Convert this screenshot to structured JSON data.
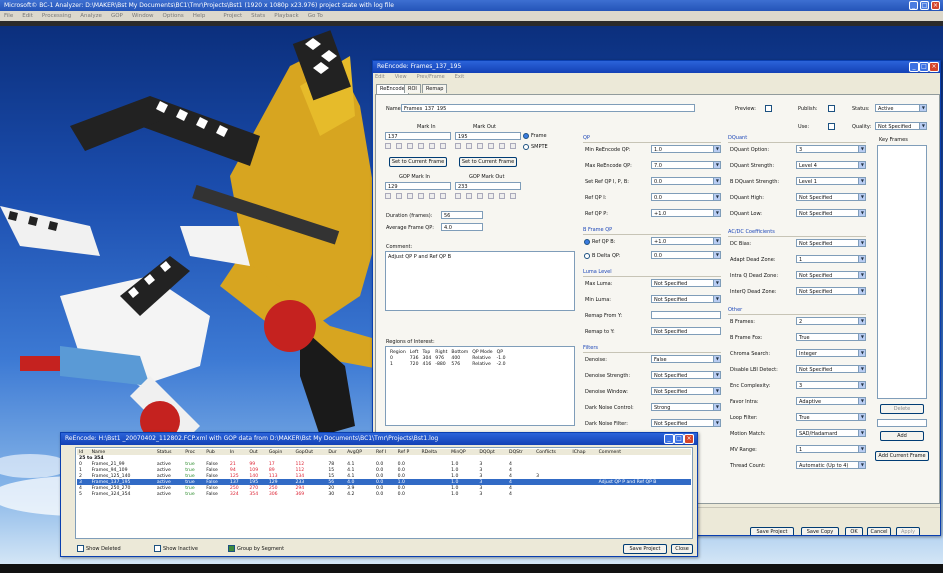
{
  "app": {
    "title": "Microsoft© BC-1 Analyzer: D:\\MAKER\\Bst  My Documents\\BC1\\Tmr\\Projects\\Bst1 (1920 x 1080p x23.976) project state with log file",
    "menu": [
      "File",
      "Edit",
      "Processing",
      "Analyze",
      "GOP",
      "Window",
      "Options",
      "Help",
      "",
      "Project",
      "Stats",
      "Playback",
      "Go To"
    ]
  },
  "reencode": {
    "title": "ReEncode: Frames_137_195",
    "menu": [
      "Edit",
      "View",
      "Prev/Frame",
      "Exit"
    ],
    "tabs": [
      "ReEncode",
      "ROI",
      "Remap"
    ],
    "name_label": "Name:",
    "name_value": "Frames_137_195",
    "mark_in_label": "Mark In",
    "mark_out_label": "Mark Out",
    "mark_in": "137",
    "mark_out": "195",
    "frame_label": "Frame",
    "smpte_label": "SMPTE",
    "set_current_label": "Set to Current Frame",
    "gop_in_label": "GOP Mark In",
    "gop_out_label": "GOP Mark Out",
    "gop_in": "129",
    "gop_out": "233",
    "duration_label": "Duration (frames):",
    "duration": "56",
    "avg_qp_label": "Average Frame QP:",
    "avg_qp": "4.0",
    "comment_label": "Comment:",
    "comment": "Adjust QP P and Ref QP B",
    "qp_group": "QP",
    "qp": [
      {
        "label": "Min ReEncode QP:",
        "value": "1.0"
      },
      {
        "label": "Max ReEncode QP:",
        "value": "7.0"
      },
      {
        "label": "Set Ref QP I, P, B:",
        "value": "0.0"
      },
      {
        "label": "Ref QP I:",
        "value": "0.0"
      },
      {
        "label": "Ref QP P:",
        "value": "+1.0"
      }
    ],
    "bframe_group": "B Frame QP",
    "bframe": [
      {
        "label": "Ref QP B:",
        "value": "+1.0"
      },
      {
        "label": "B Delta QP:",
        "value": "0.0"
      }
    ],
    "luma_group": "Luma Level",
    "luma": [
      {
        "label": "Max Luma:",
        "value": "Not Specified"
      },
      {
        "label": "Min Luma:",
        "value": "Not Specified"
      },
      {
        "label": "Remap From Y:",
        "value": ""
      },
      {
        "label": "Remap to Y:",
        "value": "Not Specified"
      }
    ],
    "filter_group": "Filters",
    "filters": [
      {
        "label": "Denoise:",
        "value": "False"
      },
      {
        "label": "Denoise Strength:",
        "value": "Not Specified"
      },
      {
        "label": "Denoise Window:",
        "value": "Not Specified"
      },
      {
        "label": "Dark Noise Control:",
        "value": "Strong"
      },
      {
        "label": "Dark Noise Filter:",
        "value": "Not Specified"
      }
    ],
    "dquant_group": "DQuant",
    "dquant": [
      {
        "label": "DQuant Option:",
        "value": "3"
      },
      {
        "label": "DQuant Strength:",
        "value": "Level 4"
      },
      {
        "label": "B DQuant Strength:",
        "value": "Level 1"
      },
      {
        "label": "DQuant High:",
        "value": "Not Specified"
      },
      {
        "label": "DQuant Low:",
        "value": "Not Specified"
      }
    ],
    "acdc_group": "AC/DC Coefficients",
    "acdc": [
      {
        "label": "DC Bias:",
        "value": "Not Specified"
      },
      {
        "label": "Adapt Dead Zone:",
        "value": "1"
      },
      {
        "label": "Intra Q Dead Zone:",
        "value": "Not Specified"
      },
      {
        "label": "InterQ Dead Zone:",
        "value": "Not Specified"
      }
    ],
    "other_group": "Other",
    "other": [
      {
        "label": "B Frames:",
        "value": "2"
      },
      {
        "label": "B Frame Fox:",
        "value": "True"
      },
      {
        "label": "Chroma Search:",
        "value": "Integer"
      },
      {
        "label": "Disable LBI Detect:",
        "value": "Not Specified"
      },
      {
        "label": "Enc Complexity:",
        "value": "3"
      },
      {
        "label": "Favor Intra:",
        "value": "Adaptive"
      },
      {
        "label": "Loop Filter:",
        "value": "True"
      },
      {
        "label": "Motion Match:",
        "value": "SAD/Hadamard"
      },
      {
        "label": "MV Range:",
        "value": "1"
      },
      {
        "label": "Thread Count:",
        "value": "Automatic (Up to 4)"
      }
    ],
    "preview_label": "Preview:",
    "publish_label": "Publish:",
    "use_label": "Use:",
    "status_label": "Status:",
    "status_value": "Active",
    "quality_label": "Quality:",
    "quality_value": "Not Specified",
    "keyframes_label": "Key Frames",
    "delete_label": "Delete",
    "add_label": "Add",
    "add_current_label": "Add Current Frame",
    "roi_label": "Regions of Interest:",
    "roi_headers": [
      "Region",
      "Left",
      "Top",
      "Right",
      "Bottom",
      "QP Mode",
      "QP"
    ],
    "roi_rows": [
      [
        "0",
        "736",
        "304",
        "976",
        "400",
        "Relative",
        "-1.0"
      ],
      [
        "1",
        "720",
        "416",
        "-880",
        "576",
        "Relative",
        "-2.0"
      ]
    ],
    "buttons": [
      "Save Project",
      "Save Copy",
      "OK",
      "Cancel",
      "Apply"
    ]
  },
  "segments": {
    "title": "ReEncode: H:\\Bst1 _20070402_112802.FCP.xml with GOP data from D:\\MAKER\\Bst  My Documents\\BC1\\Tmr\\Projects\\Bst1.log",
    "headers": [
      "Id",
      "Name",
      "Status",
      "Proc",
      "Pub",
      "In",
      "Out",
      "Gopin",
      "GopOut",
      "Dur",
      "AvgQP",
      "Ref I",
      "Ref P",
      "RDelta",
      "MinQP",
      "DQOpt",
      "DQStr",
      "Conflicts",
      "IChap",
      "Comment"
    ],
    "range_label": "25 to 354",
    "rows": [
      [
        "0",
        "Frames_21_99",
        "active",
        "true",
        "False",
        "21",
        "99",
        "17",
        "112",
        "78",
        "4.1",
        "0.0",
        "0.0",
        "",
        "1.0",
        "3",
        "4",
        "",
        "",
        ""
      ],
      [
        "1",
        "Frames_94_109",
        "active",
        "true",
        "False",
        "94",
        "109",
        "89",
        "112",
        "15",
        "4.1",
        "0.0",
        "0.0",
        "",
        "1.0",
        "3",
        "4",
        "",
        "",
        ""
      ],
      [
        "2",
        "Frames_125_140",
        "active",
        "true",
        "False",
        "125",
        "140",
        "113",
        "134",
        "15",
        "4.1",
        "0.0",
        "0.0",
        "",
        "1.0",
        "3",
        "4",
        "3",
        "",
        ""
      ],
      [
        "3",
        "Frames_137_195",
        "active",
        "true",
        "False",
        "137",
        "195",
        "129",
        "233",
        "56",
        "4.0",
        "0.0",
        "1.0",
        "",
        "1.0",
        "3",
        "4",
        "",
        "",
        "Adjust QP P and Ref QP B"
      ],
      [
        "4",
        "Frames_250_270",
        "active",
        "true",
        "False",
        "250",
        "270",
        "250",
        "294",
        "20",
        "3.9",
        "0.0",
        "0.0",
        "",
        "1.0",
        "3",
        "4",
        "",
        "",
        ""
      ],
      [
        "5",
        "Frames_324_354",
        "active",
        "true",
        "False",
        "324",
        "354",
        "306",
        "369",
        "30",
        "4.2",
        "0.0",
        "0.0",
        "",
        "1.0",
        "3",
        "4",
        "",
        "",
        ""
      ]
    ],
    "show_deleted": "Show Deleted",
    "show_inactive": "Show Inactive",
    "group_by_segment": "Group by Segment",
    "save_project": "Save Project",
    "close": "Close"
  }
}
